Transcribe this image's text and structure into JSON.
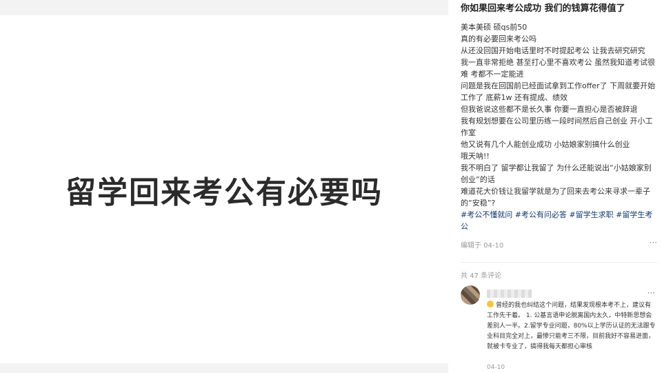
{
  "image": {
    "text": "留学回来考公有必要吗"
  },
  "post": {
    "title": "你如果回来考公成功 我们的钱算花得值了",
    "body": [
      "美本美硕 硕qs前50",
      "真的有必要回来考公吗",
      "从还没回国开始电话里时不时提起考公 让我去研究研究",
      "我一直非常拒绝 甚至打心里不喜欢考公 虽然我知道考试很难 考都不一定能进",
      "问题是我在回国前已经面试拿到工作offer了 下周就要开始工作了 底薪1w 还有提成、绩效",
      "但我爸说这些都不是长久事 你要一直担心是否被辞退",
      "我有规划想要在公司里历练一段时间然后自己创业 开小工作室",
      "他又说有几个人能创业成功 小姑娘家别搞什么创业",
      "哦天呐!!",
      "我不明白了 留学都让我留了 为什么还能说出“小姑娘家别创业”的话",
      "难道花大价钱让我留学就是为了回来去考公来寻求一辈子的“安稳”?"
    ],
    "tags": "#考公不懂就问 #考公有问必答 #留学生求职 #留学生考公",
    "edited": "编辑于 04-10",
    "more": "···"
  },
  "comments": {
    "count_label": "共 47 条评论",
    "items": [
      {
        "text": "曾经的我也纠结这个问题，结果发现根本考不上，建议有工作先干着。 1. 公基言语申论脱离国内太久，中特新思想会差别人一半。2.留学专业问题，80%以上学历认证的无法跟专业科目完全对上，最惨只能考三不限，目前我好不容易进面，就被卡专业了，搞得我每天都担心审核",
        "date": "04-10",
        "more": "···"
      }
    ]
  }
}
